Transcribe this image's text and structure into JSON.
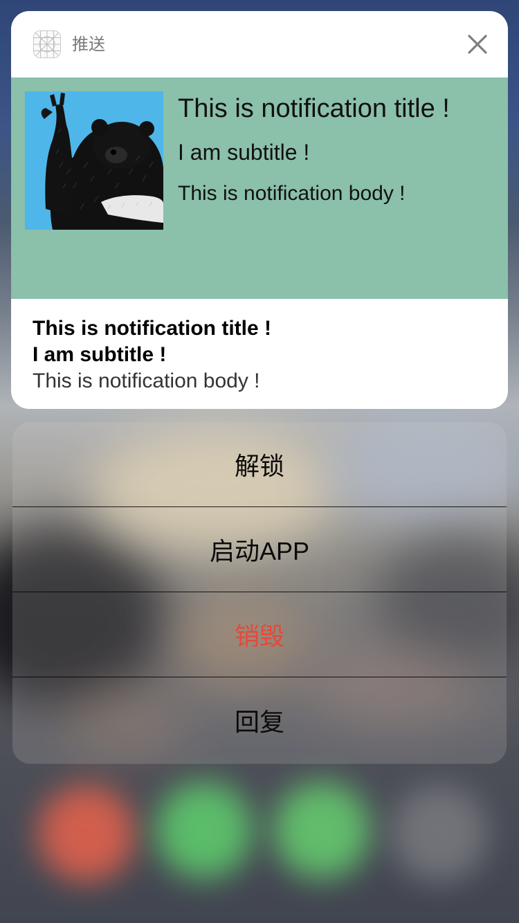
{
  "notification": {
    "app_name": "推送",
    "app_icon": "grid-app-icon",
    "close_icon": "close-icon",
    "media": {
      "image": "bear-raising-hand-illustration",
      "background_color": "#8bc0ab",
      "title": "This is notification title !",
      "subtitle": "I am subtitle !",
      "body": "This is notification body !"
    },
    "title": "This is notification title !",
    "subtitle": "I am subtitle !",
    "body": "This is notification body !"
  },
  "actions": [
    {
      "label": "解锁",
      "destructive": false
    },
    {
      "label": "启动APP",
      "destructive": false
    },
    {
      "label": "销毁",
      "destructive": true
    },
    {
      "label": "回复",
      "destructive": false
    }
  ],
  "colors": {
    "destructive": "#e5493a",
    "card": "#ffffff"
  }
}
